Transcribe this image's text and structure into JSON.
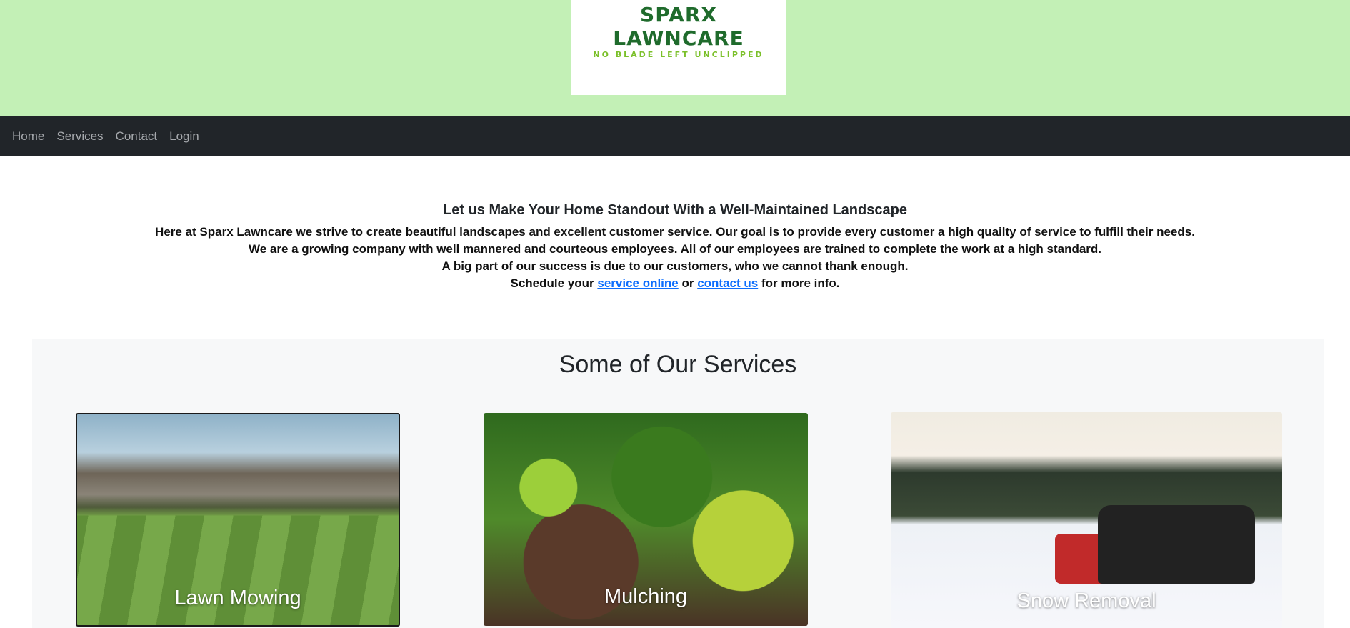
{
  "brand": {
    "name": "SPARX LAWNCARE",
    "tagline": "NO BLADE LEFT UNCLIPPED"
  },
  "nav": {
    "items": [
      {
        "label": "Home"
      },
      {
        "label": "Services"
      },
      {
        "label": "Contact"
      },
      {
        "label": "Login"
      }
    ]
  },
  "intro": {
    "heading": "Let us Make Your Home Standout With a Well-Maintained Landscape",
    "line1": "Here at Sparx Lawncare we strive to create beautiful landscapes and excellent customer service. Our goal is to provide every customer a high quailty of service to fulfill their needs.",
    "line2": "We are a growing company with well mannered and courteous employees. All of our employees are trained to complete the work at a high standard.",
    "line3": "A big part of our success is due to our customers, who we cannot thank enough.",
    "line4_prefix": "Schedule your ",
    "link_service": "service online",
    "line4_mid": " or ",
    "link_contact": "contact us",
    "line4_suffix": " for more info."
  },
  "services": {
    "heading": "Some of Our Services",
    "cards": [
      {
        "label": "Lawn Mowing"
      },
      {
        "label": "Mulching"
      },
      {
        "label": "Snow Removal"
      }
    ]
  },
  "colors": {
    "banner_bg": "#c3f0b6",
    "navbar_bg": "#212529",
    "link": "#0d6efd",
    "brand_dark": "#1f6b2c",
    "brand_light": "#7bc02a"
  }
}
